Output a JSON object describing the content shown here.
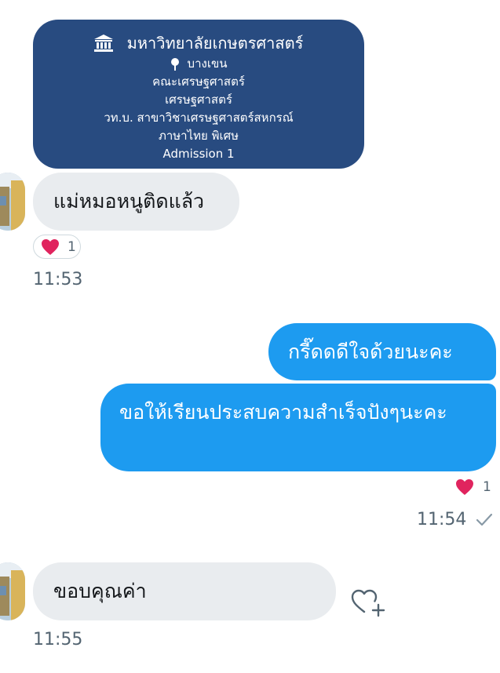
{
  "admission_card": {
    "university": "มหาวิทยาลัยเกษตรศาสตร์",
    "campus": "บางเขน",
    "faculty": "คณะเศรษฐศาสตร์",
    "department": "เศรษฐศาสตร์",
    "program": "วท.บ. สาขาวิชาเศรษฐศาสตร์สหกรณ์",
    "track": "ภาษาไทย พิเศษ",
    "round": "Admission 1",
    "university_icon": "building-columns-icon",
    "campus_icon": "map-pin-icon"
  },
  "messages": [
    {
      "direction": "in",
      "text": "แม่หมอหนูติดแล้ว",
      "reaction": "❤️",
      "reaction_count": "1",
      "time": "11:53"
    },
    {
      "direction": "out",
      "text": "กรี๊ดดดีใจด้วยนะคะ"
    },
    {
      "direction": "out",
      "text": "ขอให้เรียนประสบความสำเร็จปังๆนะคะ",
      "reaction": "❤️",
      "reaction_count": "1",
      "time": "11:54",
      "status_icon": "checkmark-icon"
    },
    {
      "direction": "in",
      "text": "ขอบคุณค่า",
      "time": "11:55",
      "action_icon": "heart-plus-icon"
    }
  ],
  "colors": {
    "outgoing_bubble": "#1d9bf0",
    "incoming_bubble": "#e9ecef",
    "card_background": "#284b80",
    "heart": "#e0245e",
    "timestamp": "#536471"
  }
}
